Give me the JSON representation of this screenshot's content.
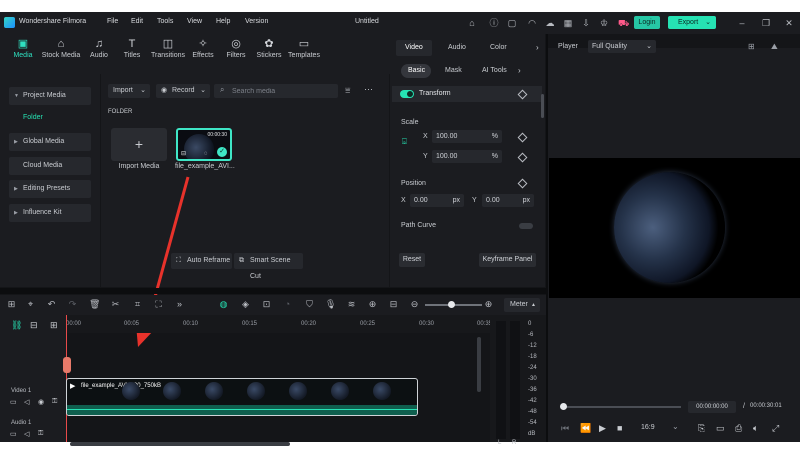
{
  "app": {
    "name": "Wondershare Filmora",
    "doc_title": "Untitled"
  },
  "menu": [
    "File",
    "Edit",
    "Tools",
    "View",
    "Help",
    "Version"
  ],
  "header": {
    "login": "Login",
    "export": "Export"
  },
  "media_tabs": [
    {
      "label": "Media",
      "icon": "media-icon"
    },
    {
      "label": "Stock Media",
      "icon": "stock-media-icon"
    },
    {
      "label": "Audio",
      "icon": "audio-icon"
    },
    {
      "label": "Titles",
      "icon": "titles-icon"
    },
    {
      "label": "Transitions",
      "icon": "transitions-icon"
    },
    {
      "label": "Effects",
      "icon": "effects-icon"
    },
    {
      "label": "Filters",
      "icon": "filters-icon"
    },
    {
      "label": "Stickers",
      "icon": "stickers-icon"
    },
    {
      "label": "Templates",
      "icon": "templates-icon"
    }
  ],
  "sidebar": {
    "items": [
      "Project Media",
      "Global Media",
      "Cloud Media",
      "Editing Presets",
      "Influence Kit"
    ],
    "folder": "Folder"
  },
  "media": {
    "import_btn": "Import",
    "record_btn": "Record",
    "search_placeholder": "Search media",
    "folder_label": "FOLDER",
    "import_tile": "Import Media",
    "clip_name": "file_example_AVI...",
    "clip_duration": "00:00:30",
    "auto_reframe": "Auto Reframe",
    "smart_scene_cut": "Smart Scene Cut"
  },
  "properties": {
    "tabs": [
      "Video",
      "Audio",
      "Color"
    ],
    "subtabs": [
      "Basic",
      "Mask",
      "AI Tools"
    ],
    "transform": "Transform",
    "scale": "Scale",
    "scale_x_label": "X",
    "scale_x": "100.00",
    "scale_y_label": "Y",
    "scale_y": "100.00",
    "percent": "%",
    "position": "Position",
    "pos_x_label": "X",
    "pos_x": "0.00",
    "pos_y_label": "Y",
    "pos_y": "0.00",
    "px": "px",
    "path_curve": "Path Curve",
    "reset": "Reset",
    "keyframe_panel": "Keyframe Panel"
  },
  "player": {
    "label": "Player",
    "quality": "Full Quality",
    "current_time": "00:00:00:00",
    "separator": "/",
    "total_time": "00:00:30:01",
    "aspect": "16:9"
  },
  "timeline": {
    "meter_label": "Meter",
    "ruler": [
      "00:00",
      "00:05",
      "00:10",
      "00:15",
      "00:20",
      "00:25",
      "00:30",
      "00:35"
    ],
    "meter_levels": [
      "0",
      "-6",
      "-12",
      "-18",
      "-24",
      "-30",
      "-36",
      "-42",
      "-48",
      "-54",
      "dB"
    ],
    "meter_channels": [
      "L",
      "R"
    ],
    "video_track": "Video 1",
    "audio_track": "Audio 1",
    "clip_name": "file_example_AVI_480_750kB"
  }
}
